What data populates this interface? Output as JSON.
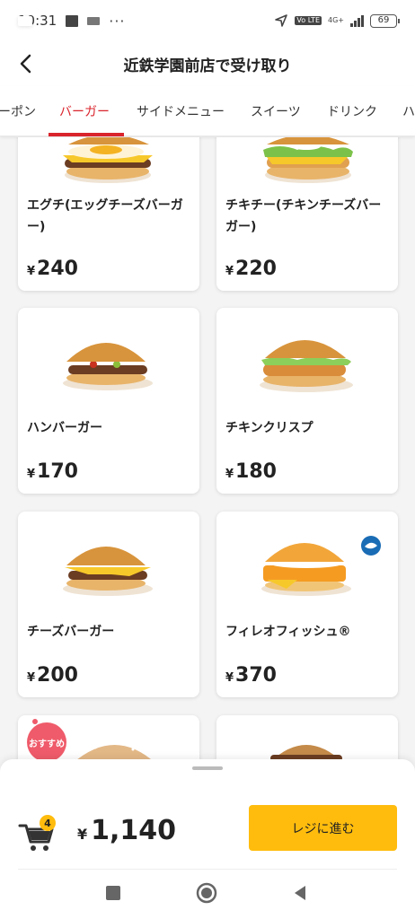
{
  "status_bar": {
    "time": "10:31",
    "network": "4G+",
    "volte": "Vo LTE",
    "battery": "69"
  },
  "header": {
    "title": "近鉄学園前店で受け取り"
  },
  "tabs": [
    {
      "label": "ーポン",
      "active": false
    },
    {
      "label": "バーガー",
      "active": true
    },
    {
      "label": "サイドメニュー",
      "active": false
    },
    {
      "label": "スイーツ",
      "active": false
    },
    {
      "label": "ドリンク",
      "active": false
    },
    {
      "label": "ハ",
      "active": false
    }
  ],
  "products": [
    {
      "name": "エグチ(エッグチーズバーガー)",
      "price": "240",
      "currency": "¥",
      "image": "egg-cheese-burger"
    },
    {
      "name": "チキチー(チキンチーズバーガー)",
      "price": "220",
      "currency": "¥",
      "image": "chicken-cheese-burger"
    },
    {
      "name": "ハンバーガー",
      "price": "170",
      "currency": "¥",
      "image": "hamburger"
    },
    {
      "name": "チキンクリスプ",
      "price": "180",
      "currency": "¥",
      "image": "chicken-crisp"
    },
    {
      "name": "チーズバーガー",
      "price": "200",
      "currency": "¥",
      "image": "cheeseburger"
    },
    {
      "name": "フィレオフィッシュ®",
      "price": "370",
      "currency": "¥",
      "image": "filet-o-fish",
      "badge": "MSC"
    },
    {
      "name": "",
      "price": "",
      "currency": "",
      "image": "recommended-burger",
      "badge_text": "おすすめ"
    },
    {
      "name": "",
      "price": "",
      "currency": "",
      "image": "big-mac"
    }
  ],
  "cart": {
    "count": "4",
    "currency": "¥",
    "total": "1,140",
    "checkout_label": "レジに進む"
  },
  "colors": {
    "accent_red": "#d9242c",
    "accent_yellow": "#ffbc0d"
  }
}
